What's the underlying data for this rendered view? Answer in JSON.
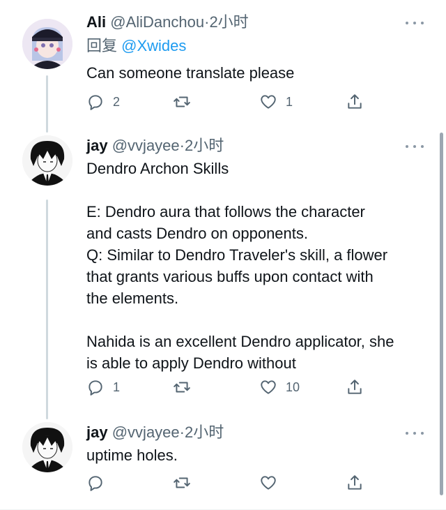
{
  "tweets": [
    {
      "name": "Ali",
      "handle": "@AliDanchou",
      "dot": "·",
      "time": "2小时",
      "reply_prefix": "回复",
      "reply_mention": "@Xwides",
      "text": "Can someone translate please",
      "reply_count": "2",
      "retweet_count": "",
      "like_count": "1"
    },
    {
      "name": "jay",
      "handle": "@vvjayee",
      "dot": "·",
      "time": "2小时",
      "text": "Dendro Archon Skills\n\nE: Dendro aura that follows the character\nand casts Dendro on opponents.\nQ: Similar to Dendro Traveler's skill, a flower\nthat grants various buffs upon contact with\nthe elements.\n\nNahida is an excellent Dendro applicator, she\nis able to apply Dendro without",
      "reply_count": "1",
      "retweet_count": "",
      "like_count": "10"
    },
    {
      "name": "jay",
      "handle": "@vvjayee",
      "dot": "·",
      "time": "2小时",
      "text": "uptime holes.",
      "reply_count": "",
      "retweet_count": "",
      "like_count": ""
    }
  ],
  "icons": {
    "reply": "reply-icon",
    "retweet": "retweet-icon",
    "like": "heart-icon",
    "share": "share-icon",
    "more": "more-icon"
  },
  "colors": {
    "link": "#1d9bf0",
    "secondary_text": "#536471",
    "thread_line": "#cfd9de"
  }
}
